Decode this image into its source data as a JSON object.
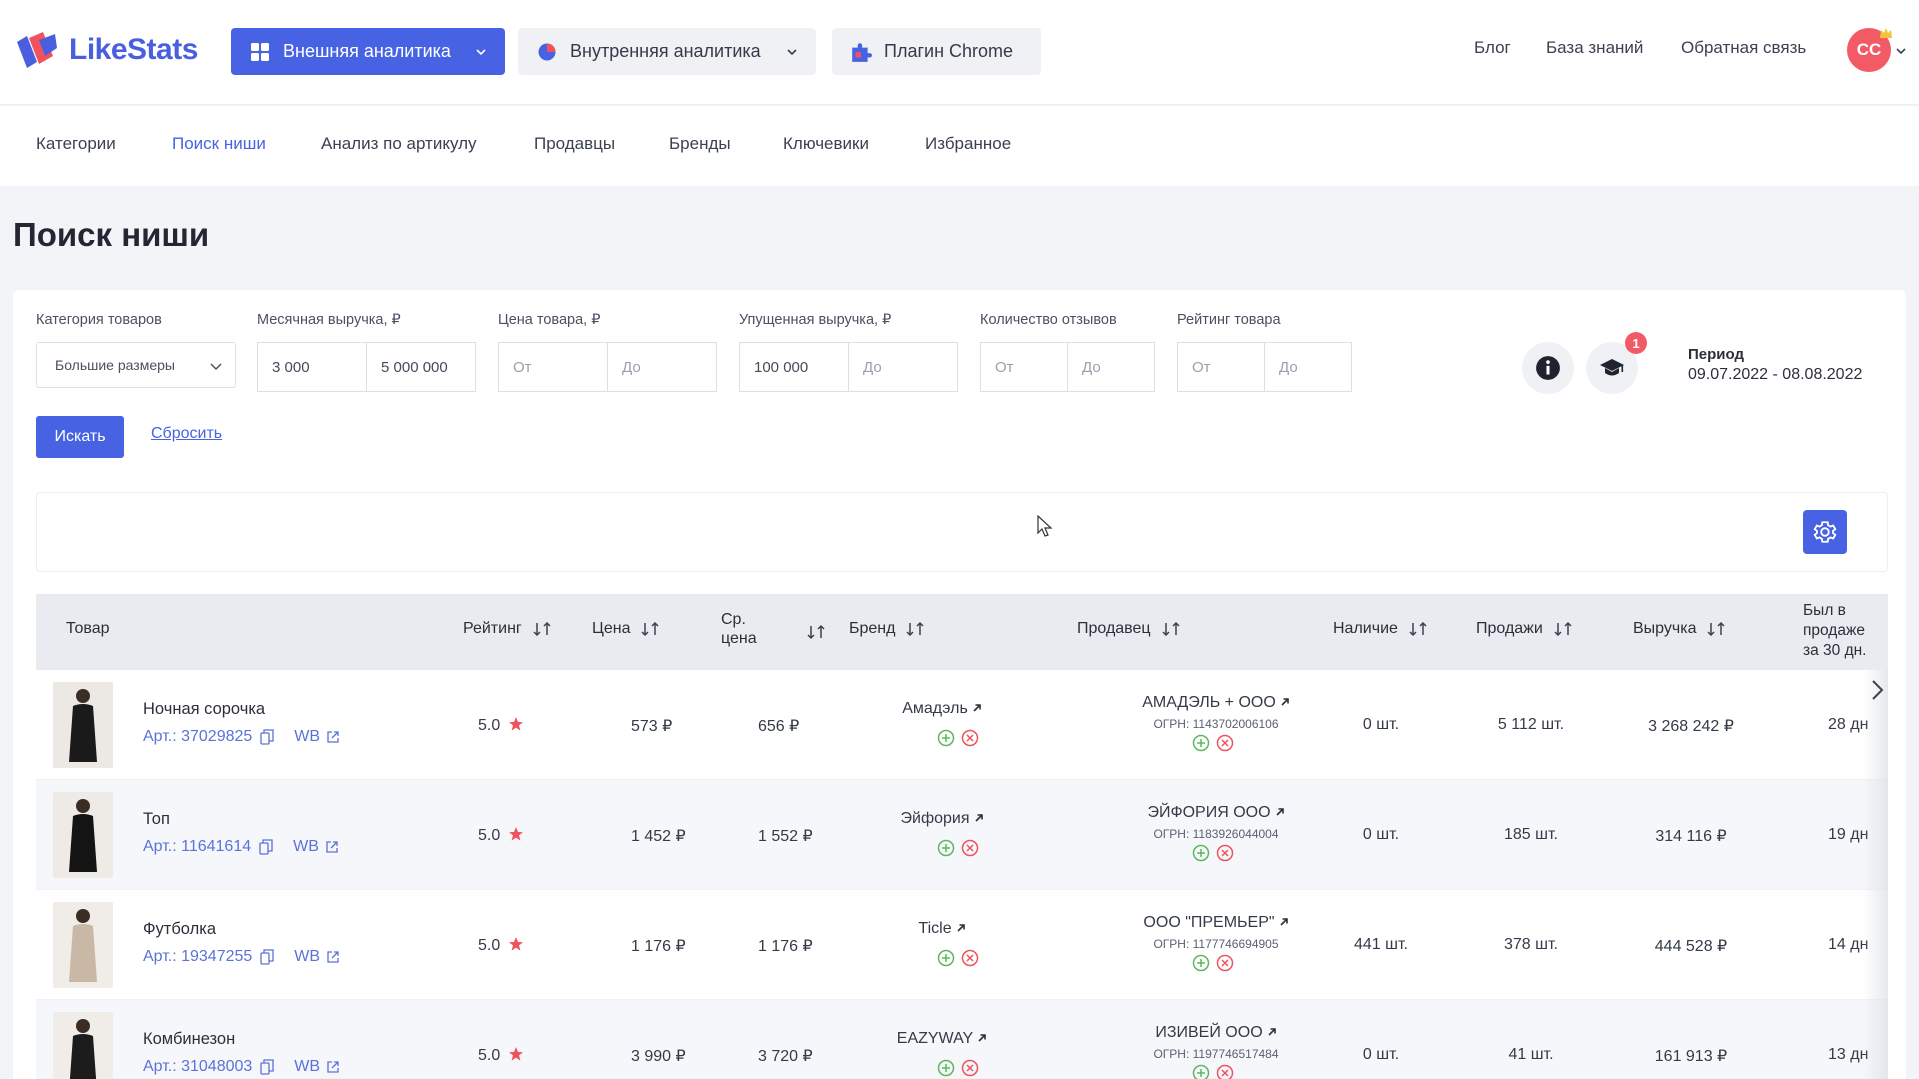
{
  "header": {
    "logo_text": "LikeStats",
    "nav": [
      {
        "label": "Внешняя аналитика"
      },
      {
        "label": "Внутренняя аналитика"
      },
      {
        "label": "Плагин Chrome"
      }
    ],
    "links": [
      "Блог",
      "База знаний",
      "Обратная связь"
    ],
    "avatar_initials": "CC"
  },
  "subnav": {
    "items": [
      "Категории",
      "Поиск ниши",
      "Анализ по артикулу",
      "Продавцы",
      "Бренды",
      "Ключевики",
      "Избранное"
    ],
    "active": "Поиск ниши"
  },
  "page_title": "Поиск ниши",
  "filters": {
    "category": {
      "label": "Категория товаров",
      "value": "Большие размеры"
    },
    "revenue": {
      "label": "Месячная выручка, ₽",
      "from": "3 000",
      "to": "5 000 000"
    },
    "price": {
      "label": "Цена товара, ₽",
      "from_placeholder": "От",
      "to_placeholder": "До"
    },
    "lost_revenue": {
      "label": "Упущенная выручка, ₽",
      "from": "100 000",
      "to_placeholder": "До"
    },
    "reviews": {
      "label": "Количество отзывов",
      "from_placeholder": "От",
      "to_placeholder": "До"
    },
    "rating": {
      "label": "Рейтинг товара",
      "from_placeholder": "От",
      "to_placeholder": "До"
    },
    "badge_count": "1",
    "period_label": "Период",
    "period_value": "09.07.2022 - 08.08.2022",
    "search_label": "Искать",
    "reset_label": "Сбросить"
  },
  "table": {
    "columns": {
      "product": "Товар",
      "rating": "Рейтинг",
      "price": "Цена",
      "avg_price_1": "Ср.",
      "avg_price_2": "цена",
      "brand": "Бренд",
      "seller": "Продавец",
      "stock": "Наличие",
      "sales": "Продажи",
      "revenue": "Выручка",
      "days_1": "Был в",
      "days_2": "продаже",
      "days_3": "за 30 дн."
    },
    "rows": [
      {
        "name": "Ночная сорочка",
        "art": "Арт.: 37029825",
        "wb": "WB",
        "rating": "5.0",
        "price": "573 ₽",
        "avg_price": "656 ₽",
        "brand": "Амадэль",
        "seller": "АМАДЭЛЬ + ООО",
        "ogrn": "ОГРН: 1143702006106",
        "stock": "0 шт.",
        "sales": "5 112 шт.",
        "revenue": "3 268 242 ₽",
        "days": "28 дн"
      },
      {
        "name": "Топ",
        "art": "Арт.: 11641614",
        "wb": "WB",
        "rating": "5.0",
        "price": "1 452 ₽",
        "avg_price": "1 552 ₽",
        "brand": "Эйфория",
        "seller": "ЭЙФОРИЯ ООО",
        "ogrn": "ОГРН: 1183926044004",
        "stock": "0 шт.",
        "sales": "185 шт.",
        "revenue": "314 116 ₽",
        "days": "19 дн"
      },
      {
        "name": "Футболка",
        "art": "Арт.: 19347255",
        "wb": "WB",
        "rating": "5.0",
        "price": "1 176 ₽",
        "avg_price": "1 176 ₽",
        "brand": "Ticle",
        "seller": "ООО \"ПРЕМЬЕР\"",
        "ogrn": "ОГРН: 1177746694905",
        "stock": "441 шт.",
        "sales": "378 шт.",
        "revenue": "444 528 ₽",
        "days": "14 дн"
      },
      {
        "name": "Комбинезон",
        "art": "Арт.: 31048003",
        "wb": "WB",
        "rating": "5.0",
        "price": "3 990 ₽",
        "avg_price": "3 720 ₽",
        "brand": "EAZYWAY",
        "seller": "ИЗИВЕЙ ООО",
        "ogrn": "ОГРН: 1197746517484",
        "stock": "0 шт.",
        "sales": "41 шт.",
        "revenue": "161 913 ₽",
        "days": "13 дн"
      }
    ]
  },
  "colors": {
    "accent": "#4763e4",
    "star": "#f0525e",
    "plus": "#5cb85c",
    "minus": "#f0525e"
  }
}
